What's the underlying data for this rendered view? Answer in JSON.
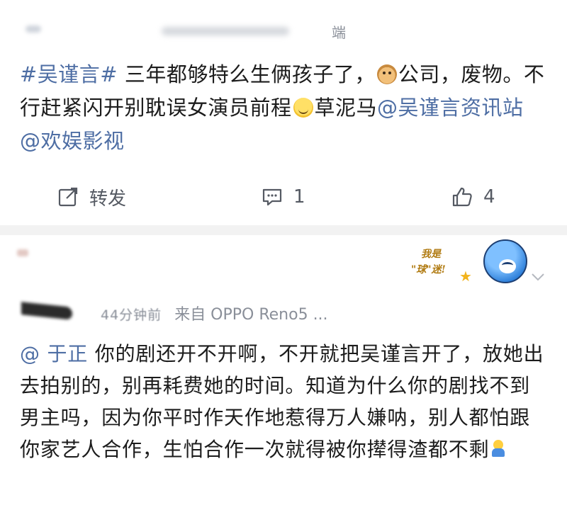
{
  "post": {
    "source_tail": "端",
    "text_parts": {
      "hashtag": "#吴谨言#",
      "part1": " 三年都够特么生俩孩子了，",
      "emoji_dog": "dog-emoji",
      "part2": "公司，废物。不行赶紧闪开别耽误女演员前程",
      "emoji_smile": "smile-emoji",
      "part3": "草泥马",
      "mention1": "@吴谨言资讯站",
      "space": " ",
      "mention2": "@欢娱影视"
    },
    "actions": {
      "repost_label": "转发",
      "comment_count": "1",
      "like_count": "4"
    }
  },
  "comment": {
    "time": "44分钟前",
    "from": "来自 OPPO Reno5 ...",
    "mention": "@ 于正",
    "text": " 你的剧还开不开啊，不开就把吴谨言开了，放她出去拍别的，别再耗费她的时间。知道为什么你的剧找不到男主吗，因为你平时作天作地惹得万人嫌呐，别人都怕跟你家艺人合作，生怕合作一次就得被你撵得渣都不剩",
    "sticker_text_line1": "我是",
    "sticker_text_line2": "\"球\"迷!"
  },
  "colors": {
    "link": "#4e6ea4",
    "meta": "#8a8f99",
    "divider": "#f2f2f2"
  }
}
